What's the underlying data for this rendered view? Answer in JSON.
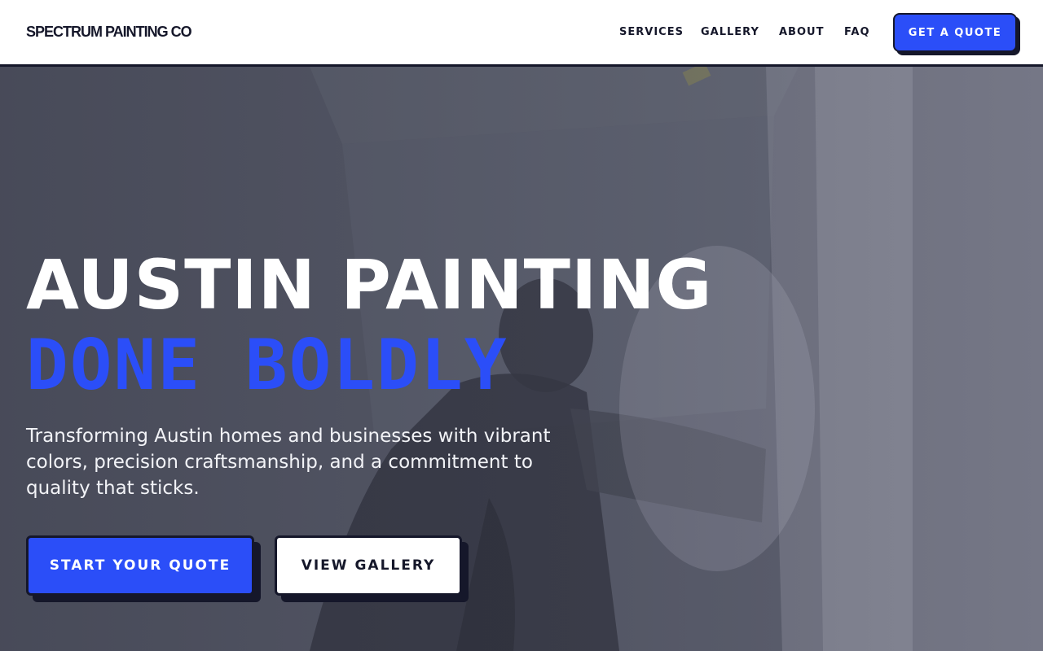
{
  "header": {
    "logo": "SPECTRUM PAINTING CO",
    "nav": [
      "SERVICES",
      "GALLERY",
      "ABOUT",
      "FAQ"
    ],
    "cta": "GET A QUOTE"
  },
  "hero": {
    "headline_line1": "AUSTIN PAINTING",
    "headline_line2": "DONE BOLDLY",
    "subtitle": "Transforming Austin homes and businesses with vibrant colors, precision craftsmanship, and a commitment to quality that sticks.",
    "primary_button": "START YOUR QUOTE",
    "secondary_button": "VIEW GALLERY"
  },
  "colors": {
    "accent": "#2b4ef8",
    "ink": "#15172a",
    "white": "#ffffff"
  }
}
